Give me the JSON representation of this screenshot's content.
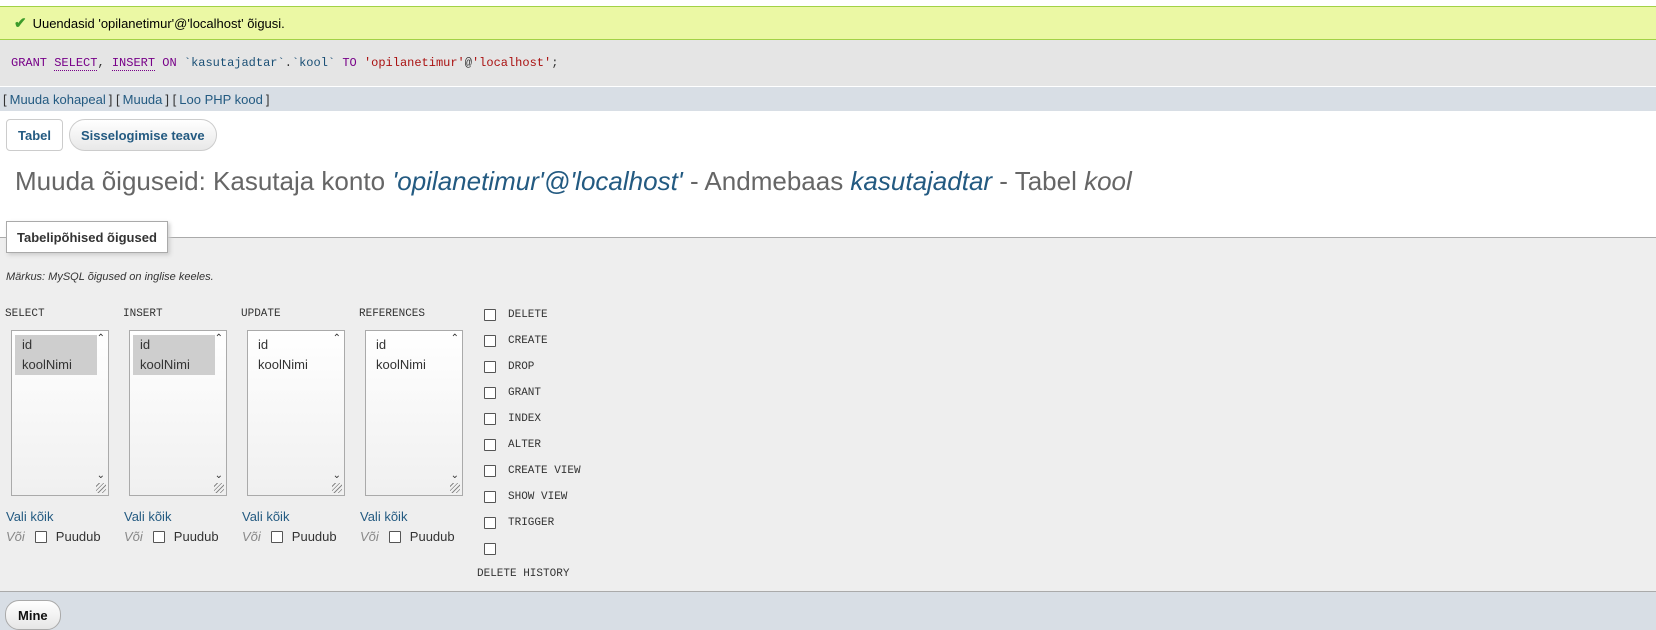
{
  "success": {
    "icon": "check-icon",
    "message": "Uuendasid 'opilanetimur'@'localhost' õigusi."
  },
  "sql": {
    "grant": "GRANT",
    "select": "SELECT",
    "comma": ",",
    "insert": "INSERT",
    "on": "ON",
    "db": "`kasutajadtar`",
    "dot": ".",
    "table": "`kool`",
    "to": "TO",
    "user": "'opilanetimur'",
    "at": "@",
    "host": "'localhost'",
    "semicolon": ";"
  },
  "links": {
    "open1": "[",
    "edit_inline": "Muuda kohapeal",
    "close1": "]",
    "open2": "[",
    "edit": "Muuda",
    "close2": "]",
    "open3": "[",
    "php": "Loo PHP kood",
    "close3": "]"
  },
  "tabs": {
    "table": "Tabel",
    "login": "Sisselogimise teave"
  },
  "heading": {
    "prefix": "Muuda õiguseid: Kasutaja konto ",
    "user": "'opilanetimur'@'localhost'",
    "db_prefix": " - Andmebaas ",
    "db": "kasutajadtar",
    "table_prefix": " - Tabel ",
    "table": "kool"
  },
  "fieldset": {
    "legend": "Tabelipõhised õigused",
    "note": "Märkus: MySQL õigused on inglise keeles.",
    "columns": [
      {
        "name": "SELECT",
        "options": [
          "id",
          "koolNimi"
        ],
        "selected": [
          true,
          true
        ]
      },
      {
        "name": "INSERT",
        "options": [
          "id",
          "koolNimi"
        ],
        "selected": [
          true,
          true
        ]
      },
      {
        "name": "UPDATE",
        "options": [
          "id",
          "koolNimi"
        ],
        "selected": [
          false,
          false
        ]
      },
      {
        "name": "REFERENCES",
        "options": [
          "id",
          "koolNimi"
        ],
        "selected": [
          false,
          false
        ]
      }
    ],
    "select_all": "Vali kõik",
    "or": "Või",
    "none": "Puudub",
    "privileges": [
      "DELETE",
      "CREATE",
      "DROP",
      "GRANT",
      "INDEX",
      "ALTER",
      "CREATE VIEW",
      "SHOW VIEW",
      "TRIGGER"
    ],
    "last_privilege": "DELETE HISTORY"
  },
  "footer": {
    "go": "Mine"
  }
}
